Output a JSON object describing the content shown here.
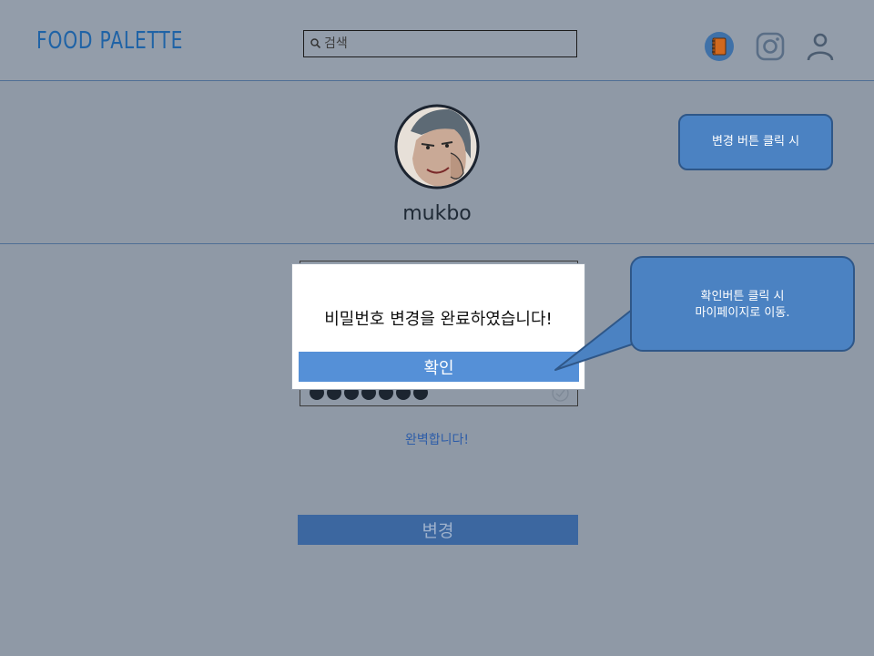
{
  "header": {
    "logo": "FOOD PALETTE",
    "search": {
      "placeholder": "검색",
      "value": ""
    },
    "icons": [
      "notebook-icon",
      "instagram-icon",
      "user-icon"
    ]
  },
  "profile": {
    "username": "mukbo"
  },
  "form": {
    "password_mask": "●●●●●●●",
    "match_message": "완벽합니다!",
    "submit_label": "변경"
  },
  "modal": {
    "message": "비밀번호 변경을 완료하였습니다!",
    "confirm_label": "확인"
  },
  "annotations": {
    "callout_change": "변경 버튼 클릭 시",
    "callout_confirm_line1": "확인버튼 클릭 시",
    "callout_confirm_line2": "마이페이지로 이동."
  },
  "colors": {
    "logo": "#1f63a6",
    "page_bg": "#8f99a6",
    "modal_button": "#5590d7",
    "change_button": "#3c67a0",
    "callout": "#4b82c2"
  }
}
